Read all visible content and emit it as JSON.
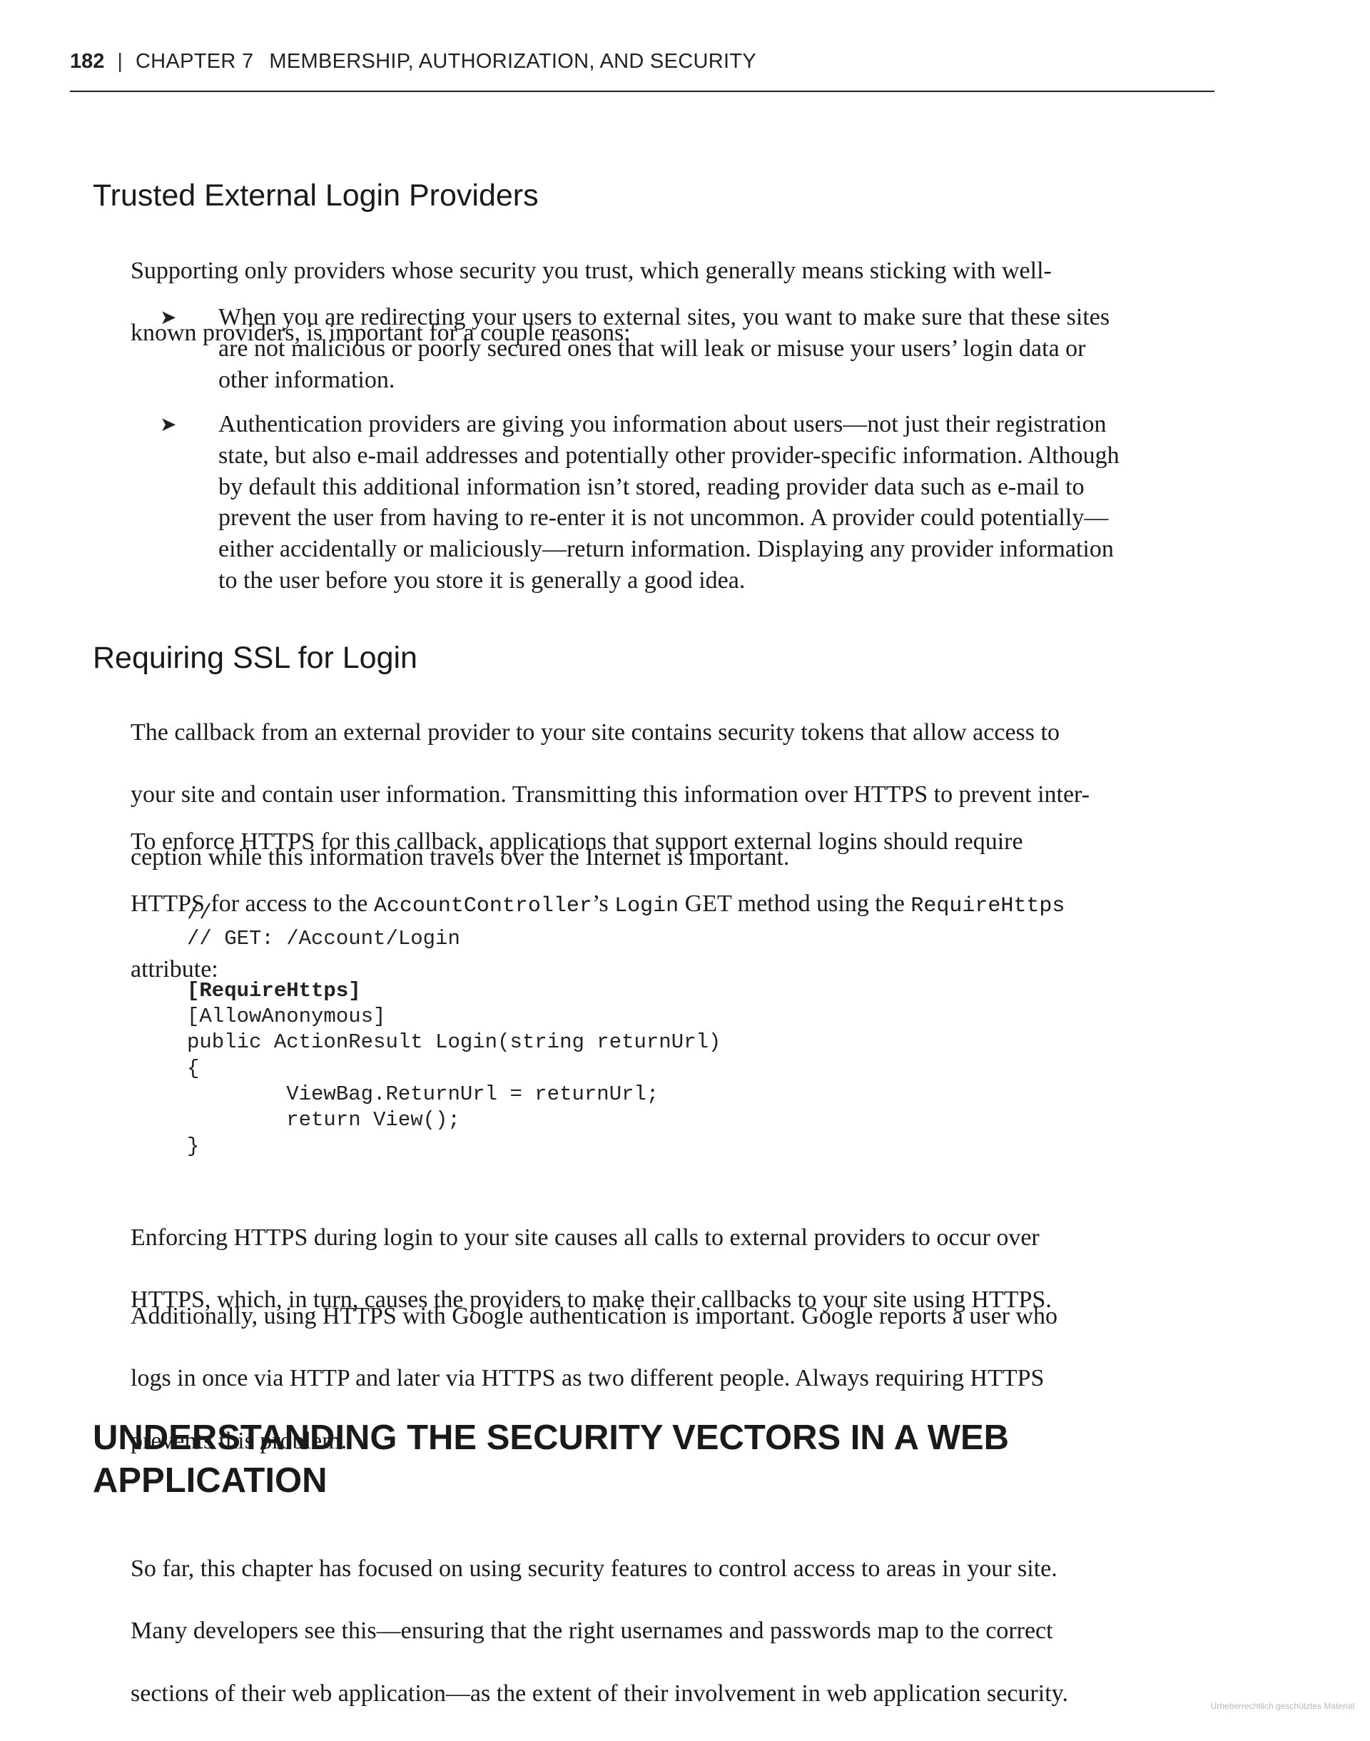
{
  "header": {
    "page_number": "182",
    "separator": "|",
    "chapter_label": "CHAPTER 7",
    "chapter_title": "MEMBERSHIP, AUTHORIZATION, AND SECURITY"
  },
  "section_trusted": {
    "heading": "Trusted External Login Providers",
    "intro_lines": [
      "Supporting only providers whose security you trust, which generally means sticking with well-",
      "known providers, is important for a couple reasons:"
    ],
    "bullet_marker": "➤",
    "bullets": [
      {
        "lines": [
          "When you are redirecting your users to external sites, you want to make sure that these sites",
          "are not malicious or poorly secured ones that will leak or misuse your users’ login data or",
          "other information."
        ]
      },
      {
        "lines": [
          "Authentication providers are giving you information about users—not just their registration",
          "state, but also e-mail addresses and potentially other provider-specific information. Although",
          "by default this additional information isn’t stored, reading provider data such as e-mail to",
          "prevent the user from having to re-enter it is not uncommon. A provider could potentially—",
          "either accidentally or maliciously—return information. Displaying any provider information",
          "to the user before you store it is generally a good idea."
        ]
      }
    ]
  },
  "section_ssl": {
    "heading": "Requiring SSL for Login",
    "para1_lines": [
      "The callback from an external provider to your site contains security tokens that allow access to",
      "your site and contain user information. Transmitting this information over HTTPS to prevent inter-",
      "ception while this information travels over the Internet is important."
    ],
    "para2": {
      "line1": "To enforce HTTPS for this callback, applications that support external logins should require",
      "line2_before": "HTTPS for access to the ",
      "line2_code1": "AccountController",
      "line2_between1": "’s ",
      "line2_code2": "Login",
      "line2_between2": " GET method using the ",
      "line2_code3": "RequireHttps",
      "line3": "attribute:"
    },
    "code_lines": [
      "//",
      "// GET: /Account/Login",
      "",
      "[RequireHttps]",
      "[AllowAnonymous]",
      "public ActionResult Login(string returnUrl)",
      "{",
      "        ViewBag.ReturnUrl = returnUrl;",
      "        return View();",
      "}"
    ],
    "code_bold_line_index": 3,
    "para3_lines": [
      "Enforcing HTTPS during login to your site causes all calls to external providers to occur over",
      "HTTPS, which, in turn, causes the providers to make their callbacks to your site using HTTPS."
    ],
    "para4_lines": [
      "Additionally, using HTTPS with Google authentication is important. Google reports a user who",
      "logs in once via HTTP and later via HTTPS as two different people. Always requiring HTTPS",
      "prevents this problem."
    ]
  },
  "section_vectors": {
    "heading_lines": [
      "UNDERSTANDING THE SECURITY VECTORS IN A WEB",
      "APPLICATION"
    ],
    "para_lines": [
      "So far, this chapter has focused on using security features to control access to areas in your site.",
      "Many developers see this—ensuring that the right usernames and passwords map to the correct",
      "sections of their web application—as the extent of their involvement in web application security."
    ]
  },
  "watermark": "Urheberrechtlich geschütztes Material"
}
